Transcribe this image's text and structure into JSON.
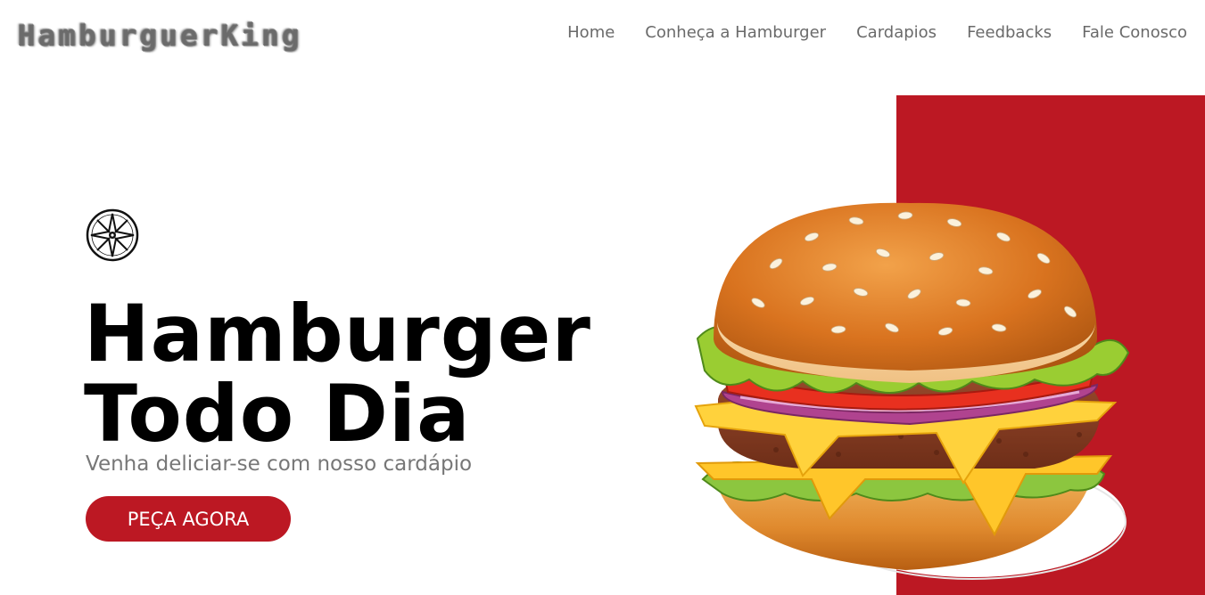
{
  "brand": {
    "logo_text": "HamburguerKing"
  },
  "nav": {
    "items": [
      "Home",
      "Conheça a Hamburger",
      "Cardapios",
      "Feedbacks",
      "Fale Conosco"
    ]
  },
  "hero": {
    "title_line1": "Hamburger",
    "title_line2": "Todo Dia",
    "subtitle": "Venha deliciar-se com nosso cardápio",
    "cta_label": "PEÇA AGORA",
    "emblem_icon": "compass-star-icon",
    "image_icon": "hamburger-illustration"
  },
  "colors": {
    "accent": "#bc1823",
    "nav_text": "#6a6a6a",
    "headline": "#000000",
    "subtitle": "#777777"
  }
}
